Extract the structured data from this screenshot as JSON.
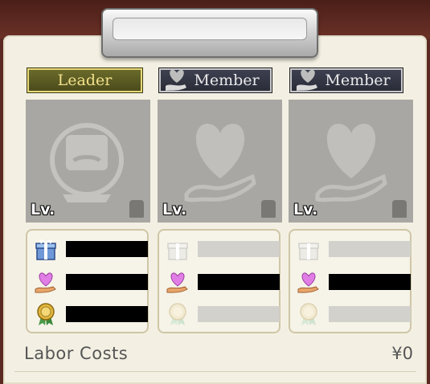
{
  "party": {
    "leader_tab": "Leader",
    "members": [
      {
        "tab": "Leader",
        "level_label": "Lv.",
        "role": "leader"
      },
      {
        "tab": "Member",
        "level_label": "Lv.",
        "role": "member"
      },
      {
        "tab": "Member",
        "level_label": "Lv.",
        "role": "member"
      }
    ]
  },
  "footer": {
    "label": "Labor Costs",
    "value": "¥0"
  },
  "colors": {
    "leader_tab_text": "#f2e08a",
    "member_tab_bg": "#2a2c38",
    "portrait_bg": "#a9a7a3"
  },
  "icons": [
    "gift-icon",
    "heart-hand-icon",
    "medal-icon",
    "slot-icon"
  ]
}
